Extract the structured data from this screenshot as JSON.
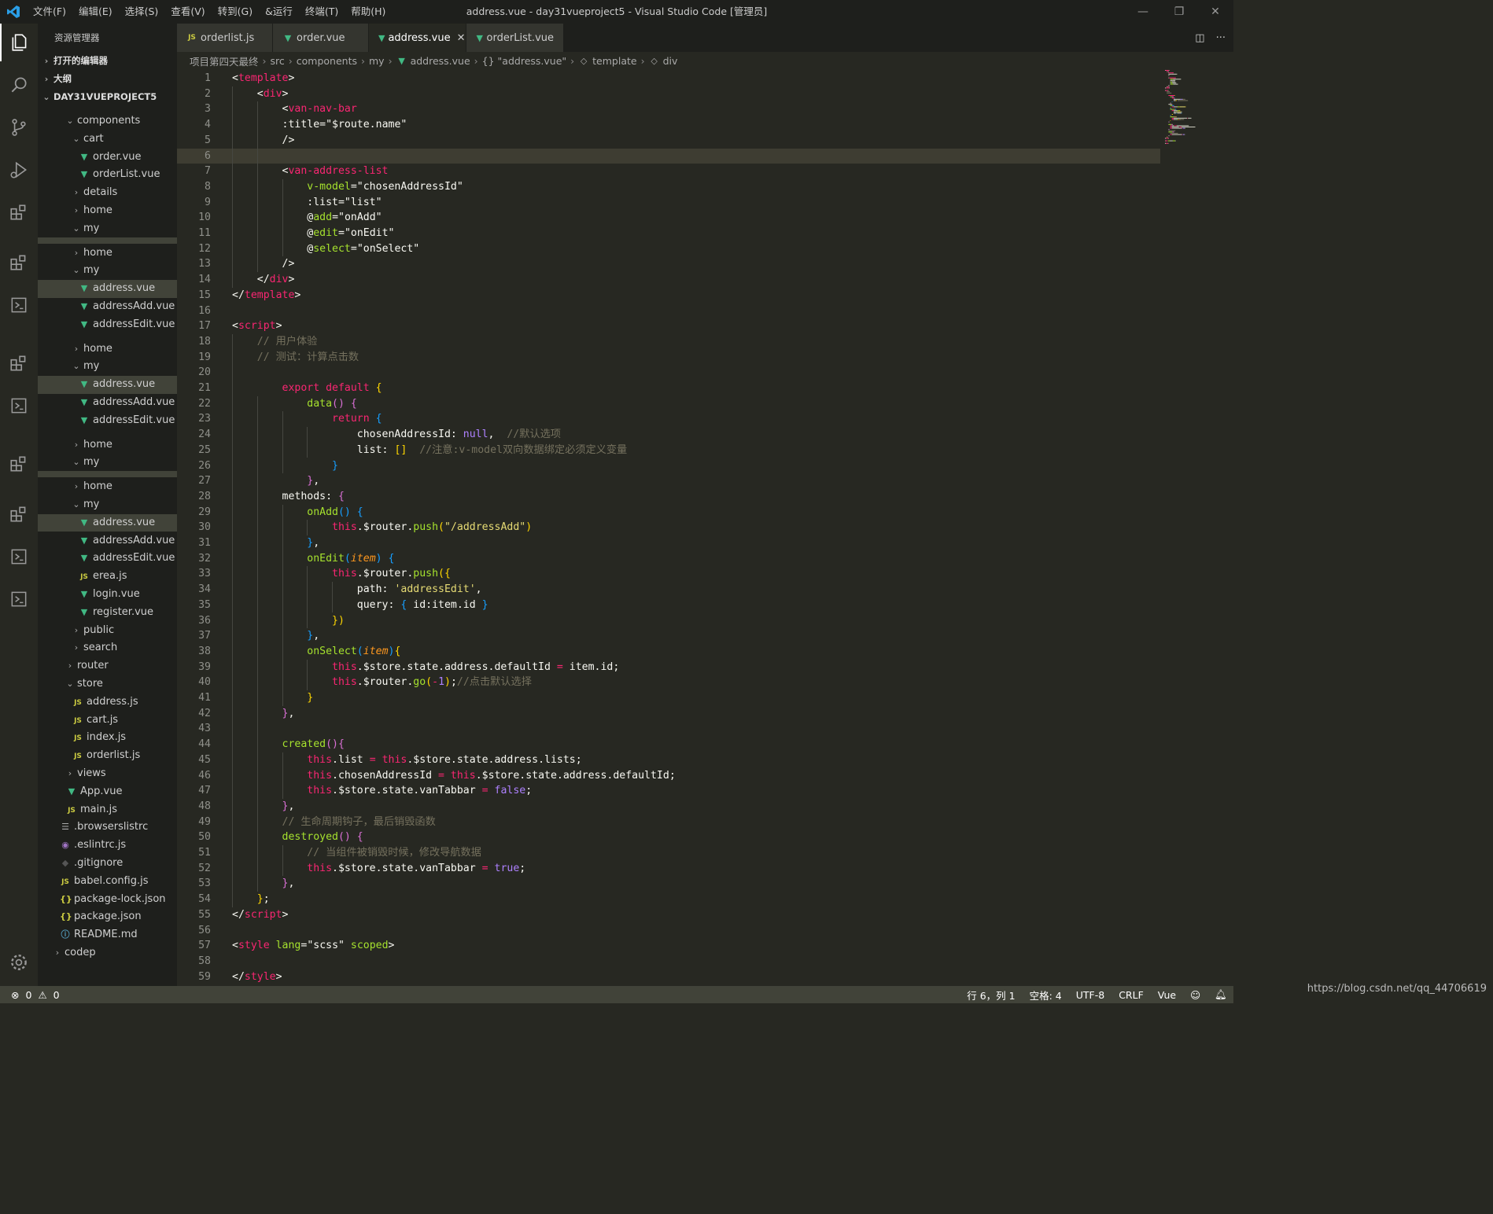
{
  "titlebar": {
    "menus": [
      "文件(F)",
      "编辑(E)",
      "选择(S)",
      "查看(V)",
      "转到(G)",
      "&运行",
      "终端(T)",
      "帮助(H)"
    ],
    "title": "address.vue - day31vueproject5 - Visual Studio Code [管理员]"
  },
  "activity": [
    "explorer-icon",
    "search-icon",
    "source-control-icon",
    "run-debug-icon",
    "extensions-icon",
    "settings-gear-icon"
  ],
  "sidebar": {
    "title": "资源管理器",
    "sections": [
      "打开的编辑器",
      "大纲",
      "DAY31VUEPROJECT5"
    ],
    "tree": [
      {
        "label": "components",
        "depth": 2,
        "kind": "folder-open"
      },
      {
        "label": "cart",
        "depth": 3,
        "kind": "folder-open"
      },
      {
        "label": "order.vue",
        "depth": 4,
        "kind": "vue"
      },
      {
        "label": "orderList.vue",
        "depth": 4,
        "kind": "vue"
      },
      {
        "label": "details",
        "depth": 3,
        "kind": "folder"
      },
      {
        "label": "home",
        "depth": 3,
        "kind": "folder"
      },
      {
        "label": "my",
        "depth": 3,
        "kind": "folder-open"
      },
      {
        "label": "home",
        "depth": 3,
        "kind": "folder"
      },
      {
        "label": "my",
        "depth": 3,
        "kind": "folder-open"
      },
      {
        "label": "address.vue",
        "depth": 4,
        "kind": "vue",
        "selected": true
      },
      {
        "label": "addressAdd.vue",
        "depth": 4,
        "kind": "vue"
      },
      {
        "label": "addressEdit.vue",
        "depth": 4,
        "kind": "vue"
      },
      {
        "label": "home",
        "depth": 3,
        "kind": "folder"
      },
      {
        "label": "my",
        "depth": 3,
        "kind": "folder-open"
      },
      {
        "label": "address.vue",
        "depth": 4,
        "kind": "vue",
        "selected": true
      },
      {
        "label": "addressAdd.vue",
        "depth": 4,
        "kind": "vue"
      },
      {
        "label": "addressEdit.vue",
        "depth": 4,
        "kind": "vue"
      },
      {
        "label": "home",
        "depth": 3,
        "kind": "folder"
      },
      {
        "label": "my",
        "depth": 3,
        "kind": "folder-open"
      },
      {
        "label": "home",
        "depth": 3,
        "kind": "folder"
      },
      {
        "label": "my",
        "depth": 3,
        "kind": "folder-open"
      },
      {
        "label": "address.vue",
        "depth": 4,
        "kind": "vue",
        "selected": true
      },
      {
        "label": "addressAdd.vue",
        "depth": 4,
        "kind": "vue"
      },
      {
        "label": "addressEdit.vue",
        "depth": 4,
        "kind": "vue"
      },
      {
        "label": "erea.js",
        "depth": 4,
        "kind": "js"
      },
      {
        "label": "login.vue",
        "depth": 4,
        "kind": "vue"
      },
      {
        "label": "register.vue",
        "depth": 4,
        "kind": "vue"
      },
      {
        "label": "public",
        "depth": 3,
        "kind": "folder"
      },
      {
        "label": "search",
        "depth": 3,
        "kind": "folder"
      },
      {
        "label": "router",
        "depth": 2,
        "kind": "folder"
      },
      {
        "label": "store",
        "depth": 2,
        "kind": "folder-open"
      },
      {
        "label": "address.js",
        "depth": 3,
        "kind": "js"
      },
      {
        "label": "cart.js",
        "depth": 3,
        "kind": "js"
      },
      {
        "label": "index.js",
        "depth": 3,
        "kind": "js"
      },
      {
        "label": "orderlist.js",
        "depth": 3,
        "kind": "js"
      },
      {
        "label": "views",
        "depth": 2,
        "kind": "folder"
      },
      {
        "label": "App.vue",
        "depth": 2,
        "kind": "vue"
      },
      {
        "label": "main.js",
        "depth": 2,
        "kind": "js"
      },
      {
        "label": ".browserslistrc",
        "depth": 1,
        "kind": "cfg"
      },
      {
        "label": ".eslintrc.js",
        "depth": 1,
        "kind": "esl"
      },
      {
        "label": ".gitignore",
        "depth": 1,
        "kind": "git"
      },
      {
        "label": "babel.config.js",
        "depth": 1,
        "kind": "js"
      },
      {
        "label": "package-lock.json",
        "depth": 1,
        "kind": "json"
      },
      {
        "label": "package.json",
        "depth": 1,
        "kind": "json"
      },
      {
        "label": "README.md",
        "depth": 1,
        "kind": "info"
      },
      {
        "label": "codep",
        "depth": 0,
        "kind": "folder"
      }
    ]
  },
  "tabs": [
    {
      "label": "orderlist.js",
      "kind": "js"
    },
    {
      "label": "order.vue",
      "kind": "vue"
    },
    {
      "label": "address.vue",
      "kind": "vue",
      "active": true
    },
    {
      "label": "orderList.vue",
      "kind": "vue"
    }
  ],
  "breadcrumb": [
    "项目第四天最终",
    "src",
    "components",
    "my",
    "address.vue",
    "{} \"address.vue\"",
    "template",
    "div"
  ],
  "editor": {
    "current_line": 6,
    "lines": [
      [
        [
          "p",
          "<"
        ],
        [
          "t",
          "template"
        ],
        [
          "p",
          ">"
        ]
      ],
      [
        [
          "p",
          "    <"
        ],
        [
          "t",
          "div"
        ],
        [
          "p",
          ">"
        ]
      ],
      [
        [
          "p",
          "        <"
        ],
        [
          "t",
          "van-nav-bar"
        ]
      ],
      [
        [
          "p",
          "        :title=\""
        ],
        [
          "p",
          "$route.name"
        ],
        [
          "p",
          "\""
        ]
      ],
      [
        [
          "p",
          "        />"
        ]
      ],
      [
        [
          "p",
          ""
        ]
      ],
      [
        [
          "p",
          "        <"
        ],
        [
          "t",
          "van-address-list"
        ]
      ],
      [
        [
          "p",
          "            "
        ],
        [
          "a",
          "v-model"
        ],
        [
          "p",
          "=\"chosenAddressId\""
        ]
      ],
      [
        [
          "p",
          "            "
        ],
        [
          "p",
          ":list"
        ],
        [
          "p",
          "=\"list\""
        ]
      ],
      [
        [
          "p",
          "            "
        ],
        [
          "p",
          "@"
        ],
        [
          "a",
          "add"
        ],
        [
          "p",
          "=\"onAdd\""
        ]
      ],
      [
        [
          "p",
          "            "
        ],
        [
          "p",
          "@"
        ],
        [
          "a",
          "edit"
        ],
        [
          "p",
          "=\"onEdit\""
        ]
      ],
      [
        [
          "p",
          "            "
        ],
        [
          "p",
          "@"
        ],
        [
          "a",
          "select"
        ],
        [
          "p",
          "=\"onSelect\""
        ]
      ],
      [
        [
          "p",
          "        />"
        ]
      ],
      [
        [
          "p",
          "    </"
        ],
        [
          "t",
          "div"
        ],
        [
          "p",
          ">"
        ]
      ],
      [
        [
          "p",
          "</"
        ],
        [
          "t",
          "template"
        ],
        [
          "p",
          ">"
        ]
      ],
      [
        [
          "p",
          ""
        ]
      ],
      [
        [
          "p",
          "<"
        ],
        [
          "t",
          "script"
        ],
        [
          "p",
          ">"
        ]
      ],
      [
        [
          "c",
          "    // 用户体验"
        ]
      ],
      [
        [
          "c",
          "    // 测试：计算点击数"
        ]
      ],
      [
        [
          "p",
          ""
        ]
      ],
      [
        [
          "k",
          "        export default "
        ],
        [
          "b1",
          "{"
        ]
      ],
      [
        [
          "f",
          "            data"
        ],
        [
          "b2",
          "() {"
        ]
      ],
      [
        [
          "k",
          "                return "
        ],
        [
          "b3",
          "{"
        ]
      ],
      [
        [
          "p",
          "                    chosenAddressId: "
        ],
        [
          "n",
          "null"
        ],
        [
          "p",
          ",  "
        ],
        [
          "c",
          "//默认选项"
        ]
      ],
      [
        [
          "p",
          "                    list: "
        ],
        [
          "b1",
          "[]"
        ],
        [
          "p",
          "  "
        ],
        [
          "c",
          "//注意:v-model双向数据绑定必须定义变量"
        ]
      ],
      [
        [
          "b3",
          "                }"
        ]
      ],
      [
        [
          "b2",
          "            }"
        ],
        [
          "p",
          ","
        ]
      ],
      [
        [
          "p",
          "        methods: "
        ],
        [
          "b2",
          "{"
        ]
      ],
      [
        [
          "f",
          "            onAdd"
        ],
        [
          "b3",
          "() {"
        ]
      ],
      [
        [
          "k",
          "                this"
        ],
        [
          "p",
          "."
        ],
        [
          "p",
          "$router."
        ],
        [
          "f",
          "push"
        ],
        [
          "b1",
          "("
        ],
        [
          "s",
          "\"/addressAdd\""
        ],
        [
          "b1",
          ")"
        ]
      ],
      [
        [
          "b3",
          "            }"
        ],
        [
          "p",
          ","
        ]
      ],
      [
        [
          "f",
          "            onEdit"
        ],
        [
          "b3",
          "("
        ],
        [
          "v",
          "item"
        ],
        [
          "b3",
          ") {"
        ]
      ],
      [
        [
          "k",
          "                this"
        ],
        [
          "p",
          ".$router."
        ],
        [
          "f",
          "push"
        ],
        [
          "b1",
          "({"
        ]
      ],
      [
        [
          "p",
          "                    path: "
        ],
        [
          "s",
          "'addressEdit'"
        ],
        [
          "p",
          ","
        ]
      ],
      [
        [
          "p",
          "                    query: "
        ],
        [
          "b3",
          "{"
        ],
        [
          "p",
          " id:item.id "
        ],
        [
          "b3",
          "}"
        ]
      ],
      [
        [
          "b1",
          "                })"
        ]
      ],
      [
        [
          "b3",
          "            }"
        ],
        [
          "p",
          ","
        ]
      ],
      [
        [
          "f",
          "            onSelect"
        ],
        [
          "b3",
          "("
        ],
        [
          "v",
          "item"
        ],
        [
          "b3",
          ")"
        ],
        [
          "b1",
          "{"
        ]
      ],
      [
        [
          "k",
          "                this"
        ],
        [
          "p",
          ".$store.state.address.defaultId "
        ],
        [
          "k",
          "="
        ],
        [
          "p",
          " item.id;"
        ]
      ],
      [
        [
          "k",
          "                this"
        ],
        [
          "p",
          ".$router."
        ],
        [
          "f",
          "go"
        ],
        [
          "b1",
          "("
        ],
        [
          "k",
          "-"
        ],
        [
          "n",
          "1"
        ],
        [
          "b1",
          ")"
        ],
        [
          "p",
          ";"
        ],
        [
          "c",
          "//点击默认选择"
        ]
      ],
      [
        [
          "b1",
          "            }"
        ]
      ],
      [
        [
          "b2",
          "        }"
        ],
        [
          "p",
          ","
        ]
      ],
      [
        [
          "p",
          ""
        ]
      ],
      [
        [
          "f",
          "        created"
        ],
        [
          "b2",
          "(){"
        ]
      ],
      [
        [
          "k",
          "            this"
        ],
        [
          "p",
          ".list "
        ],
        [
          "k",
          "="
        ],
        [
          "k",
          " this"
        ],
        [
          "p",
          ".$store.state.address.lists;"
        ]
      ],
      [
        [
          "k",
          "            this"
        ],
        [
          "p",
          ".chosenAddressId "
        ],
        [
          "k",
          "="
        ],
        [
          "k",
          " this"
        ],
        [
          "p",
          ".$store.state.address.defaultId;"
        ]
      ],
      [
        [
          "k",
          "            this"
        ],
        [
          "p",
          ".$store.state.vanTabbar "
        ],
        [
          "k",
          "="
        ],
        [
          "n",
          " false"
        ],
        [
          "p",
          ";"
        ]
      ],
      [
        [
          "b2",
          "        }"
        ],
        [
          "p",
          ","
        ]
      ],
      [
        [
          "c",
          "        // 生命周期钩子，最后销毁函数"
        ]
      ],
      [
        [
          "f",
          "        destroyed"
        ],
        [
          "b2",
          "() {"
        ]
      ],
      [
        [
          "c",
          "            // 当组件被销毁时候，修改导航数据"
        ]
      ],
      [
        [
          "k",
          "            this"
        ],
        [
          "p",
          ".$store.state.vanTabbar "
        ],
        [
          "k",
          "="
        ],
        [
          "n",
          " true"
        ],
        [
          "p",
          ";"
        ]
      ],
      [
        [
          "b2",
          "        }"
        ],
        [
          "p",
          ","
        ]
      ],
      [
        [
          "b1",
          "    }"
        ],
        [
          "p",
          ";"
        ]
      ],
      [
        [
          "p",
          "</"
        ],
        [
          "t",
          "script"
        ],
        [
          "p",
          ">"
        ]
      ],
      [
        [
          "p",
          ""
        ]
      ],
      [
        [
          "p",
          "<"
        ],
        [
          "t",
          "style"
        ],
        [
          "p",
          " "
        ],
        [
          "a",
          "lang"
        ],
        [
          "p",
          "=\"scss\" "
        ],
        [
          "a",
          "scoped"
        ],
        [
          "p",
          ">"
        ]
      ],
      [
        [
          "p",
          ""
        ]
      ],
      [
        [
          "p",
          "</"
        ],
        [
          "t",
          "style"
        ],
        [
          "p",
          ">"
        ]
      ]
    ]
  },
  "statusbar": {
    "errors": "0",
    "warnings": "0",
    "position": "行 6，列 1",
    "indent": "空格: 4",
    "encoding": "UTF-8",
    "eol": "CRLF",
    "language": "Vue",
    "watermark": "https://blog.csdn.net/qq_44706619"
  }
}
